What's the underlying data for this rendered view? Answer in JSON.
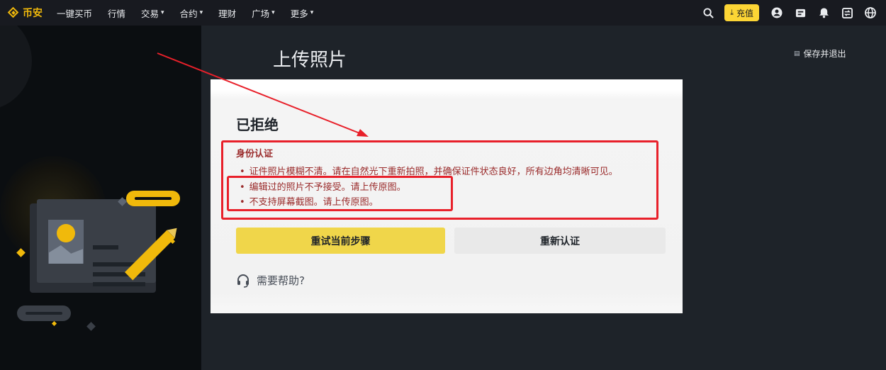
{
  "header": {
    "logo_text": "币安",
    "nav": [
      {
        "label": "一键买币",
        "dropdown": false
      },
      {
        "label": "行情",
        "dropdown": false
      },
      {
        "label": "交易",
        "dropdown": true
      },
      {
        "label": "合约",
        "dropdown": true
      },
      {
        "label": "理财",
        "dropdown": false
      },
      {
        "label": "广场",
        "dropdown": true
      },
      {
        "label": "更多",
        "dropdown": true
      }
    ],
    "deposit_label": "充值",
    "icons": [
      "search-icon",
      "download-icon",
      "user-icon",
      "wallet-icon",
      "bell-icon",
      "transfer-icon",
      "globe-icon"
    ]
  },
  "page": {
    "title": "上传照片",
    "save_exit": "保存并退出"
  },
  "result": {
    "status": "已拒绝",
    "reason_title": "身份认证",
    "reasons": [
      "证件照片模糊不清。请在自然光下重新拍照，并确保证件状态良好，所有边角均清晰可见。",
      "编辑过的照片不予接受。请上传原图。",
      "不支持屏幕截图。请上传原图。"
    ],
    "bullet": "•"
  },
  "actions": {
    "retry": "重试当前步骤",
    "reverify": "重新认证"
  },
  "help": {
    "label": "需要帮助?",
    "icon": "headset-icon"
  },
  "colors": {
    "brand": "#f0b90b",
    "annotation": "#e8202a",
    "reason_text": "#9a2b2b",
    "retry_button": "#f0d64a"
  }
}
